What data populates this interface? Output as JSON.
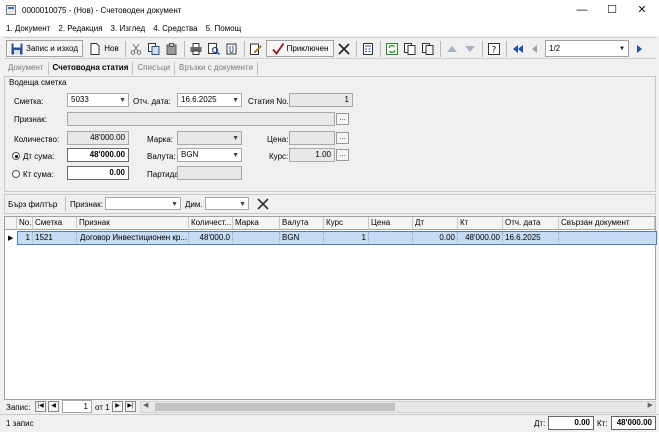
{
  "window": {
    "title": "0000010075 - (Нов) - Счетоводен документ",
    "minimize": "—",
    "maximize": "☐",
    "close": "✕"
  },
  "menu": [
    "1. Документ",
    "2. Редакция",
    "3. Изглед",
    "4. Средства",
    "5. Помощ"
  ],
  "toolbar": {
    "save_exit": "Запис и изход",
    "new": "Нов",
    "finished": "Приключен",
    "page": "1/2"
  },
  "tabs": [
    "Документ",
    "Счетоводна статия",
    "Списъци",
    "Връзки с документи"
  ],
  "form": {
    "group_title": "Водеща сметка",
    "account_label": "Сметка:",
    "account_value": "5033",
    "report_date_label": "Отч. дата:",
    "report_date_value": "16.6.2025",
    "article_no_label": "Статия No.",
    "article_no_value": "1",
    "attribute_label": "Признак:",
    "attribute_value": "",
    "quantity_label": "Количество:",
    "quantity_value": "48'000.00",
    "brand_label": "Марка:",
    "brand_value": "",
    "price_label": "Цена:",
    "price_value": "",
    "debit_label": "Дт сума:",
    "debit_value": "48'000.00",
    "currency_label": "Валута:",
    "currency_value": "BGN",
    "rate_label": "Курс:",
    "rate_value": "1.00",
    "credit_label": "Кт сума:",
    "credit_value": "0.00",
    "batch_label": "Партида:",
    "batch_value": ""
  },
  "filter": {
    "quick_filter": "Бърз филтър",
    "attribute_label": "Признак:",
    "dim_label": "Дим."
  },
  "grid": {
    "columns": [
      "No.",
      "Сметка",
      "Признак",
      "Количест...",
      "Марка",
      "Валута",
      "Курс",
      "Цена",
      "Дт",
      "Кт",
      "Отч. дата",
      "Свързан документ"
    ],
    "rows": [
      [
        "1",
        "1521",
        "Договор Инвестиционен кр...",
        "48'000.0",
        "",
        "BGN",
        "1",
        "",
        "0.00",
        "48'000.00",
        "16.6.2025",
        ""
      ]
    ]
  },
  "nav": {
    "record_label": "Запис:",
    "record_value": "1",
    "of_label": "от 1"
  },
  "status": {
    "count": "1 запис",
    "dt_label": "Дт:",
    "dt_value": "0.00",
    "kt_label": "Кт:",
    "kt_value": "48'000.00"
  }
}
